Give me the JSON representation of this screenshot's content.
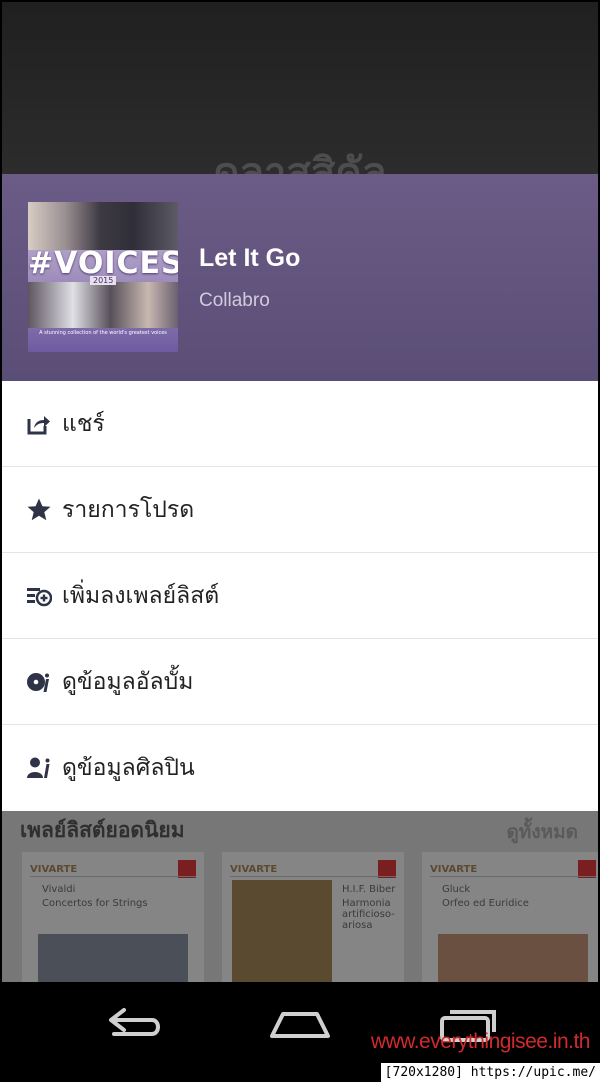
{
  "background": {
    "heading": "ดลาสสิคัล",
    "section_title": "เพลย์ลิสต์ยอดนิยม",
    "see_all": "ดูทั้งหมด",
    "cards": [
      {
        "label": "VIVARTE",
        "line1": "Vivaldi",
        "line2": "Concertos for Strings"
      },
      {
        "label": "VIVARTE",
        "line1": "H.I.F. Biber",
        "line2": "Harmonia artificioso-ariosa"
      },
      {
        "label": "VIVARTE",
        "line1": "Gluck",
        "line2": "Orfeo ed Euridice"
      }
    ]
  },
  "now_playing": {
    "album_cover_text": "#VOICES",
    "album_cover_year": "2015",
    "album_cover_tagline": "A stunning collection of the world's greatest voices",
    "title": "Let It Go",
    "artist": "Collabro"
  },
  "menu": {
    "items": [
      {
        "label": "แชร์",
        "icon": "share-icon"
      },
      {
        "label": "รายการโปรด",
        "icon": "star-icon"
      },
      {
        "label": "เพิ่มลงเพลย์ลิสต์",
        "icon": "add-to-playlist-icon"
      },
      {
        "label": "ดูข้อมูลอัลบั้ม",
        "icon": "album-info-icon"
      },
      {
        "label": "ดูข้อมูลศิลปิน",
        "icon": "artist-info-icon"
      }
    ]
  },
  "watermark": "www.everythingisee.in.th",
  "footer_url": "[720x1280] https://upic.me/",
  "colors": {
    "header_bg": "#5f5280",
    "menu_icon": "#2f3347",
    "watermark": "#d12a2a"
  }
}
